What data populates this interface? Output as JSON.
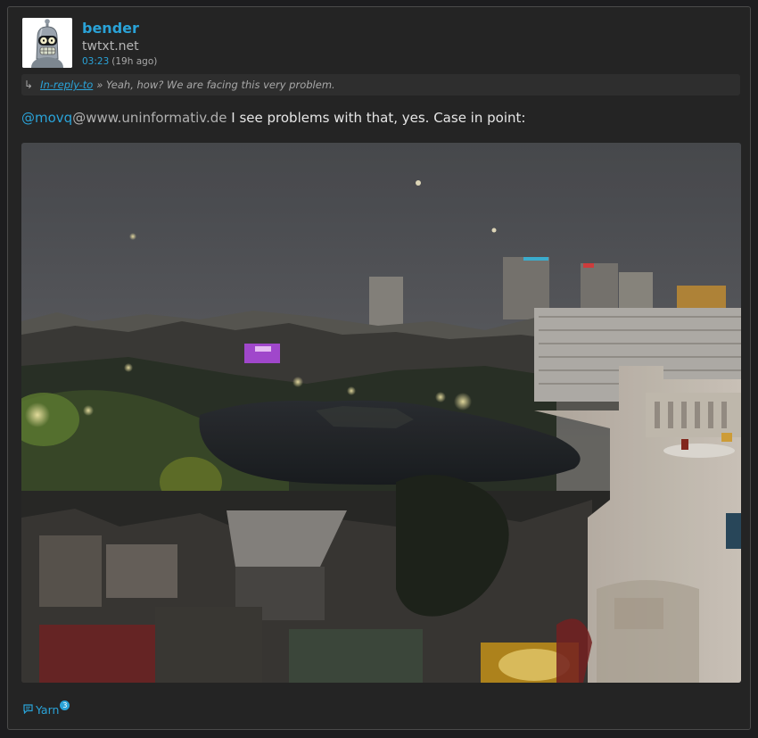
{
  "post": {
    "author": {
      "name": "bender",
      "pod": "twtxt.net",
      "avatar_icon": "bender-avatar-icon"
    },
    "time": "03:23",
    "time_ago": "(19h ago)",
    "reply": {
      "arrow_icon": "reply-arrow-icon",
      "link_label": "In-reply-to",
      "quote": "» Yeah, how? We are facing this very problem."
    },
    "content": {
      "mention_nick": "@movq",
      "mention_domain": "@www.uninformativ.de",
      "text": " I see problems with that, yes. Case in point:"
    },
    "photo": {
      "description_icon": "city-lake-night-photo"
    },
    "footer": {
      "yarn_icon": "comment-icon",
      "yarn_label": "Yarn",
      "yarn_count": "3"
    }
  },
  "colors": {
    "accent": "#2aa3d8",
    "card_background": "#242424",
    "page_background": "#1d1d1f",
    "text": "#e6e6e6",
    "muted": "#a8a8a8"
  }
}
